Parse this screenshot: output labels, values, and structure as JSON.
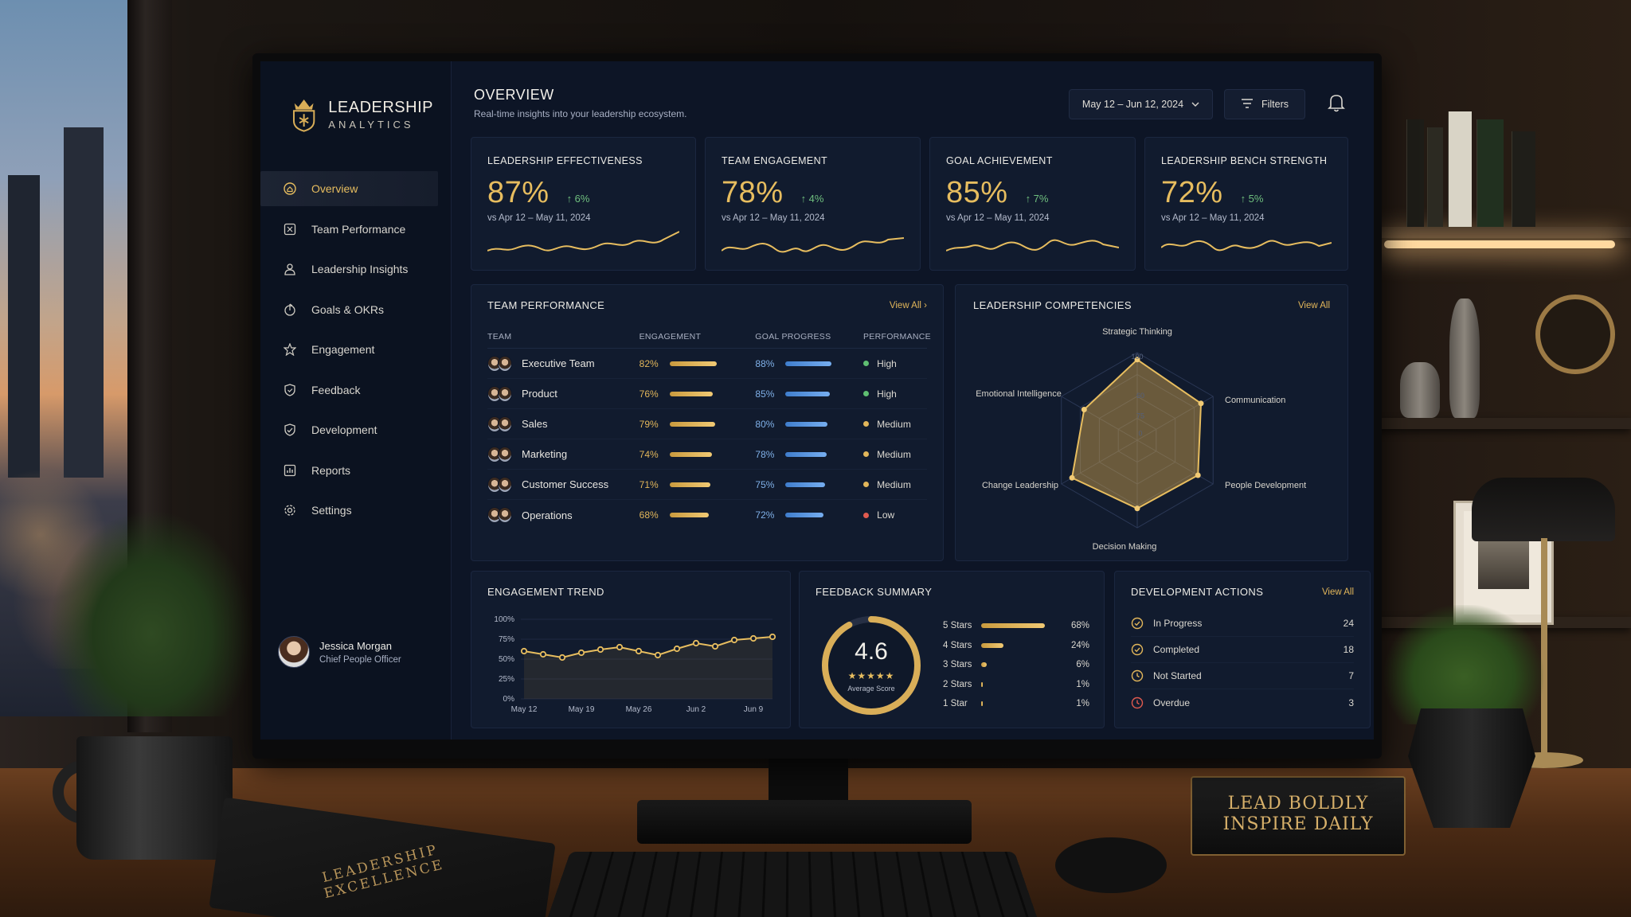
{
  "brand": {
    "title": "LEADERSHIP",
    "subtitle": "ANALYTICS"
  },
  "nav": [
    {
      "label": "Overview",
      "icon": "home-icon",
      "active": true
    },
    {
      "label": "Team Performance",
      "icon": "team-performance-icon"
    },
    {
      "label": "Leadership Insights",
      "icon": "person-icon"
    },
    {
      "label": "Goals & OKRs",
      "icon": "goal-icon"
    },
    {
      "label": "Engagement",
      "icon": "star-icon"
    },
    {
      "label": "Feedback",
      "icon": "feedback-icon"
    },
    {
      "label": "Development",
      "icon": "development-icon"
    },
    {
      "label": "Reports",
      "icon": "reports-icon"
    },
    {
      "label": "Settings",
      "icon": "gear-icon"
    }
  ],
  "user": {
    "name": "Jessica Morgan",
    "role": "Chief People Officer"
  },
  "header": {
    "title": "OVERVIEW",
    "subtitle": "Real-time insights into your leadership ecosystem.",
    "date_range": "May 12 – Jun 12, 2024",
    "filters_label": "Filters"
  },
  "kpis": [
    {
      "title": "LEADERSHIP EFFECTIVENESS",
      "value": "87%",
      "delta": "↑ 6%",
      "compare": "vs Apr 12 – May 11, 2024"
    },
    {
      "title": "TEAM ENGAGEMENT",
      "value": "78%",
      "delta": "↑ 4%",
      "compare": "vs Apr 12 – May 11, 2024"
    },
    {
      "title": "GOAL ACHIEVEMENT",
      "value": "85%",
      "delta": "↑ 7%",
      "compare": "vs Apr 12 – May 11, 2024"
    },
    {
      "title": "LEADERSHIP BENCH STRENGTH",
      "value": "72%",
      "delta": "↑ 5%",
      "compare": "vs Apr 12 – May 11, 2024"
    }
  ],
  "team_performance": {
    "title": "TEAM PERFORMANCE",
    "view_all": "View All",
    "columns": [
      "TEAM",
      "ENGAGEMENT",
      "GOAL PROGRESS",
      "PERFORMANCE"
    ],
    "rows": [
      {
        "team": "Executive Team",
        "engagement": 82,
        "engagement_label": "82%",
        "goal": 88,
        "goal_label": "88%",
        "performance": "High",
        "status_color": "#5fbf72"
      },
      {
        "team": "Product",
        "engagement": 76,
        "engagement_label": "76%",
        "goal": 85,
        "goal_label": "85%",
        "performance": "High",
        "status_color": "#5fbf72"
      },
      {
        "team": "Sales",
        "engagement": 79,
        "engagement_label": "79%",
        "goal": 80,
        "goal_label": "80%",
        "performance": "Medium",
        "status_color": "#e2b65a"
      },
      {
        "team": "Marketing",
        "engagement": 74,
        "engagement_label": "74%",
        "goal": 78,
        "goal_label": "78%",
        "performance": "Medium",
        "status_color": "#e2b65a"
      },
      {
        "team": "Customer Success",
        "engagement": 71,
        "engagement_label": "71%",
        "goal": 75,
        "goal_label": "75%",
        "performance": "Medium",
        "status_color": "#e2b65a"
      },
      {
        "team": "Operations",
        "engagement": 68,
        "engagement_label": "68%",
        "goal": 72,
        "goal_label": "72%",
        "performance": "Low",
        "status_color": "#e05a4f"
      }
    ]
  },
  "competencies": {
    "title": "LEADERSHIP COMPETENCIES",
    "view_all": "View All",
    "axes": [
      "Strategic Thinking",
      "Communication",
      "People Development",
      "Decision Making",
      "Change Leadership",
      "Emotional Intelligence"
    ],
    "values": [
      92,
      84,
      80,
      78,
      86,
      70
    ],
    "ticks": [
      "100",
      "60",
      "75",
      "0"
    ]
  },
  "chart_data": {
    "type": "line",
    "title": "ENGAGEMENT TREND",
    "x": [
      "May 12",
      "",
      "",
      "May 19",
      "",
      "",
      "May 26",
      "",
      "",
      "Jun 2",
      "",
      "",
      "Jun 9",
      ""
    ],
    "x_ticks": [
      "May 12",
      "May 19",
      "May 26",
      "Jun 2",
      "Jun 9"
    ],
    "values": [
      60,
      56,
      52,
      58,
      62,
      65,
      60,
      55,
      63,
      70,
      66,
      74,
      76,
      78
    ],
    "ylim": [
      0,
      100
    ],
    "y_ticks": [
      "100%",
      "75%",
      "50%",
      "25%",
      "0%"
    ],
    "color": "#e7bd5f",
    "grid": true
  },
  "feedback": {
    "title": "FEEDBACK SUMMARY",
    "score": "4.6",
    "stars": "★★★★★",
    "score_label": "Average Score",
    "score_fraction": 0.92,
    "rows": [
      {
        "label": "5 Stars",
        "pct": 68,
        "pct_label": "68%"
      },
      {
        "label": "4 Stars",
        "pct": 24,
        "pct_label": "24%"
      },
      {
        "label": "3 Stars",
        "pct": 6,
        "pct_label": "6%"
      },
      {
        "label": "2 Stars",
        "pct": 1,
        "pct_label": "1%"
      },
      {
        "label": "1 Star",
        "pct": 1,
        "pct_label": "1%"
      }
    ]
  },
  "development": {
    "title": "DEVELOPMENT ACTIONS",
    "view_all": "View All",
    "rows": [
      {
        "label": "In Progress",
        "count": "24",
        "icon": "check-circle-icon",
        "color": "#e2b65a"
      },
      {
        "label": "Completed",
        "count": "18",
        "icon": "check-circle-icon",
        "color": "#e2b65a"
      },
      {
        "label": "Not Started",
        "count": "7",
        "icon": "clock-icon",
        "color": "#e2b65a"
      },
      {
        "label": "Overdue",
        "count": "3",
        "icon": "clock-icon",
        "color": "#e05a4f"
      }
    ]
  },
  "room": {
    "notebook_text": "LEADERSHIP EXCELLENCE",
    "plaque_line1": "LEAD BOLDLY",
    "plaque_line2": "INSPIRE DAILY"
  },
  "colors": {
    "accent": "#e7bd5f",
    "blue": "#5b9be0",
    "background": "#0d1526",
    "card": "#111b2e"
  }
}
